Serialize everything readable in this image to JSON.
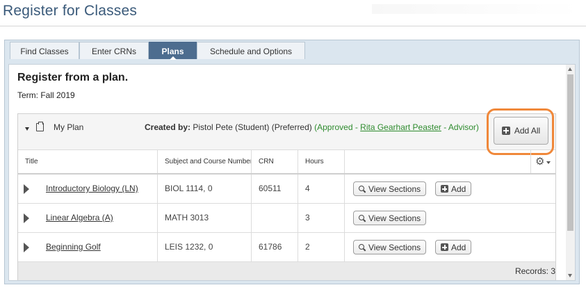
{
  "page": {
    "title": "Register for Classes"
  },
  "tabs": [
    {
      "label": "Find Classes",
      "active": false
    },
    {
      "label": "Enter CRNs",
      "active": false
    },
    {
      "label": "Plans",
      "active": true
    },
    {
      "label": "Schedule and Options",
      "active": false
    }
  ],
  "section": {
    "title": "Register from a plan.",
    "term": "Term: Fall 2019"
  },
  "plan": {
    "name": "My Plan",
    "created_by_label": "Created by:",
    "created_by_value": "Pistol Pete (Student) (Preferred)",
    "approved_prefix": "(Approved -",
    "advisor_name": "Rita Gearhart Peaster",
    "approved_suffix": "- Advisor)",
    "add_all_label": "Add All"
  },
  "table": {
    "columns": [
      "Title",
      "Subject and Course Number",
      "CRN",
      "Hours",
      ""
    ],
    "rows": [
      {
        "title": "Introductory Biology (LN)",
        "subject": "BIOL 1114, 0",
        "crn": "60511",
        "hours": "4",
        "view": "View Sections",
        "add": "Add",
        "has_add": true
      },
      {
        "title": "Linear Algebra (A)",
        "subject": "MATH 3013",
        "crn": "",
        "hours": "3",
        "view": "View Sections",
        "add": "",
        "has_add": false
      },
      {
        "title": "Beginning Golf",
        "subject": "LEIS 1232, 0",
        "crn": "61786",
        "hours": "2",
        "view": "View Sections",
        "add": "Add",
        "has_add": true
      }
    ],
    "records": "Records: 3"
  },
  "colors": {
    "title_blue": "#3a5a7a",
    "active_tab": "#4d6d8f",
    "highlight_orange": "#f0883a",
    "approved_green": "#2e8b2e"
  },
  "icons": [
    "clipboard-icon",
    "plus-icon",
    "gear-icon",
    "search-icon",
    "expand-arrow-icon"
  ]
}
